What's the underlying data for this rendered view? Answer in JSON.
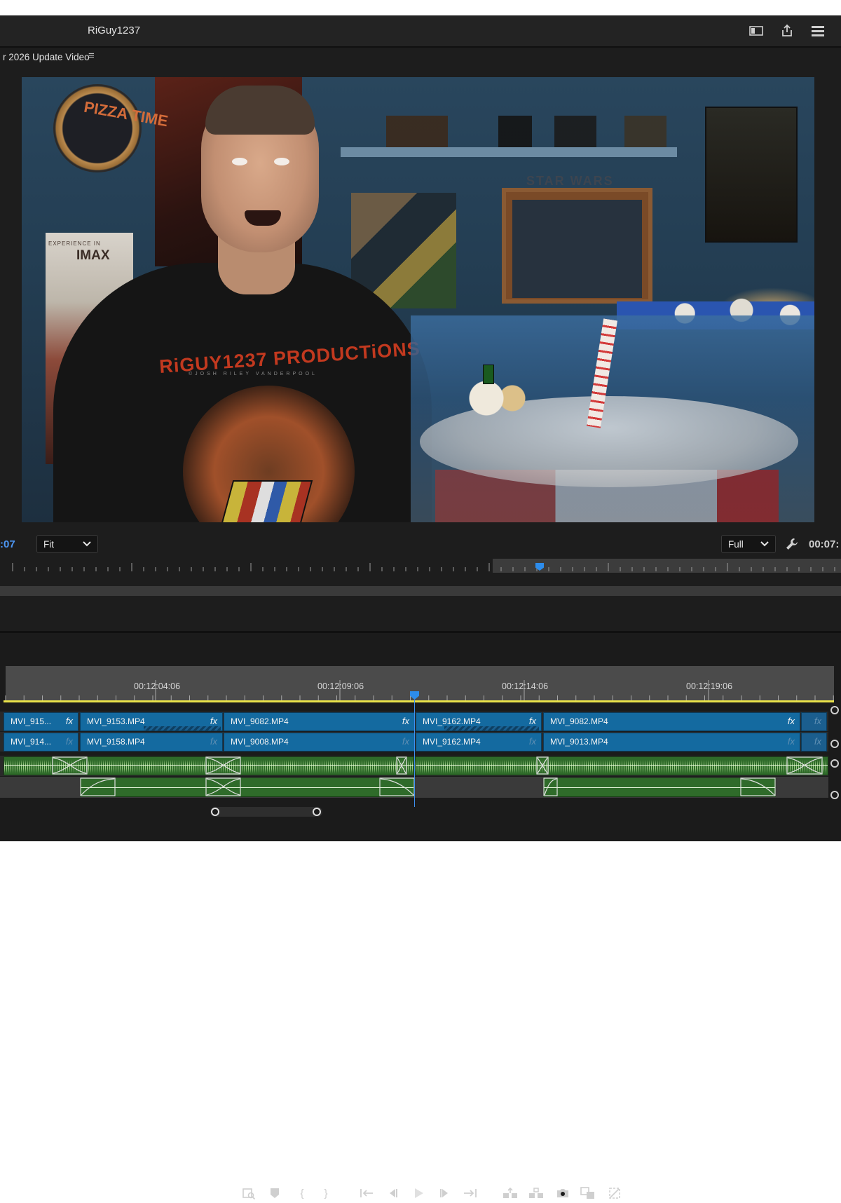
{
  "header": {
    "project_name": "RiGuy1237",
    "icons": [
      "workspace-panel-icon",
      "share-export-icon",
      "menu-lines-icon"
    ]
  },
  "monitor": {
    "sequence_name": "r 2026 Update Video",
    "menu_icon": "≡",
    "frame_text": {
      "clock": "PIZZA TIME",
      "imax_top": "EXPERIENCE IN",
      "imax": "IMAX",
      "starwars": "STAR WARS",
      "shirt_title": "RiGUY1237 PRODUCTiONS",
      "shirt_sub": "©JOSH RILEY VANDERPOOL"
    },
    "timecode_left": ":07",
    "zoom_select": "Fit",
    "quality_select": "Full",
    "timecode_right": "00:07:"
  },
  "transport_buttons": [
    "Add Marker Find",
    "Add Marker",
    "Mark In",
    "Mark Out",
    "Go to In",
    "Step Back",
    "Play",
    "Step Forward",
    "Go to Out",
    "Lift",
    "Extract",
    "Export Frame",
    "Comparison View",
    "Proxy Toggle"
  ],
  "timeline": {
    "ruler_timecodes": [
      "00:12:04:06",
      "00:12:09:06",
      "00:12:14:06",
      "00:12:19:06"
    ],
    "video_track_2": [
      {
        "name": "MVI_915...",
        "fx": "fx"
      },
      {
        "name": "MVI_9153.MP4",
        "fx": "fx"
      },
      {
        "name": "MVI_9082.MP4",
        "fx": "fx"
      },
      {
        "name": "MVI_9162.MP4",
        "fx": "fx"
      },
      {
        "name": "MVI_9082.MP4",
        "fx": "fx"
      },
      {
        "name": "",
        "fx": "fx"
      }
    ],
    "video_track_1": [
      {
        "name": "MVI_914...",
        "fx": "fx"
      },
      {
        "name": "MVI_9158.MP4",
        "fx": "fx"
      },
      {
        "name": "MVI_9008.MP4",
        "fx": "fx"
      },
      {
        "name": "MVI_9162.MP4",
        "fx": "fx"
      },
      {
        "name": "MVI_9013.MP4",
        "fx": "fx"
      },
      {
        "name": "",
        "fx": "fx"
      }
    ]
  }
}
